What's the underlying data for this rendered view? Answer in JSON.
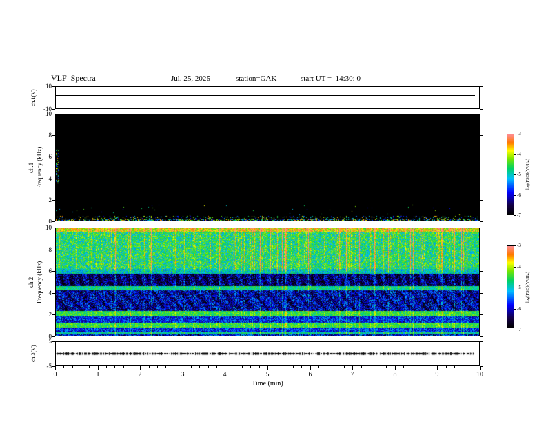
{
  "header": {
    "title": "VLF  Spectra",
    "date": "Jul. 25, 2025",
    "station": "station=GAK",
    "start_ut": "start UT =  14:30: 0"
  },
  "panels": {
    "ch1v": {
      "label": "ch.1(V)",
      "yticks": [
        "10",
        "-10"
      ],
      "ymin": -10,
      "ymax": 10
    },
    "ch1spec": {
      "label_line1": "ch.1",
      "label_line2": "Frequency (kHz)",
      "yticks": [
        "10",
        "8",
        "6",
        "4",
        "2",
        "0"
      ],
      "ymin": 0,
      "ymax": 10
    },
    "ch2spec": {
      "label_line1": "ch.2",
      "label_line2": "Frequency (kHz)",
      "yticks": [
        "10",
        "8",
        "6",
        "4",
        "2",
        "0"
      ],
      "ymin": 0,
      "ymax": 10
    },
    "ch3v": {
      "label": "ch.3(V)",
      "yticks": [
        "5",
        "-5"
      ],
      "ymin": -5,
      "ymax": 5
    }
  },
  "colorbar": {
    "label": "log(PSD)(V²/Hz)",
    "ticks": [
      "-3",
      "-4",
      "-5",
      "-6",
      "-7"
    ],
    "zmin": -7,
    "zmax": -3
  },
  "xaxis": {
    "label": "Time (min)",
    "ticks": [
      "0",
      "1",
      "2",
      "3",
      "4",
      "5",
      "6",
      "7",
      "8",
      "9",
      "10"
    ],
    "min": 0,
    "max": 10
  },
  "chart_data": [
    {
      "type": "line",
      "name": "ch.1 voltage monitor",
      "ylabel": "ch.1(V)",
      "ylim": [
        -10,
        10
      ],
      "xlim": [
        0,
        10
      ],
      "x": [
        0,
        9.9
      ],
      "values": [
        2.5,
        2.5
      ],
      "description": "flat constant trace near +2.5 V across the whole 10-minute record"
    },
    {
      "type": "heatmap",
      "subtype": "spectrogram",
      "name": "ch.1 VLF spectrogram",
      "xlabel": "Time (min)",
      "ylabel": "ch.1 Frequency (kHz)",
      "xlim": [
        0,
        10
      ],
      "ylim": [
        0,
        10
      ],
      "zlabel": "log(PSD)(V²/Hz)",
      "zlim": [
        -7,
        -3
      ],
      "seed": 11,
      "description": "power nearly everywhere at/below -7 (rendered black); sparse colored speckles in the first ~0.1 min between 3.5 and 6.8 kHz, and a thin band of scattered colored noise below ~0.4 kHz along the whole record"
    },
    {
      "type": "heatmap",
      "subtype": "spectrogram",
      "name": "ch.2 VLF spectrogram",
      "xlabel": "Time (min)",
      "ylabel": "ch.2 Frequency (kHz)",
      "xlim": [
        0,
        10
      ],
      "ylim": [
        0,
        10
      ],
      "zlabel": "log(PSD)(V²/Hz)",
      "zlim": [
        -7,
        -3
      ],
      "seed": 22,
      "bands": [
        {
          "f": [
            9.7,
            10.0
          ],
          "level": 0.8,
          "noise": 0.2
        },
        {
          "f": [
            6.2,
            9.7
          ],
          "level": 0.58,
          "noise": 0.18
        },
        {
          "f": [
            5.8,
            6.2
          ],
          "level": 0.5,
          "noise": 0.15
        },
        {
          "f": [
            4.6,
            5.8
          ],
          "level": 0.18,
          "noise": 0.22
        },
        {
          "f": [
            4.2,
            4.6
          ],
          "level": 0.55,
          "noise": 0.12
        },
        {
          "f": [
            2.3,
            4.2
          ],
          "level": 0.22,
          "noise": 0.22
        },
        {
          "f": [
            1.8,
            2.3
          ],
          "level": 0.62,
          "noise": 0.12
        },
        {
          "f": [
            1.2,
            1.8
          ],
          "level": 0.28,
          "noise": 0.18
        },
        {
          "f": [
            0.8,
            1.2
          ],
          "level": 0.62,
          "noise": 0.12
        },
        {
          "f": [
            0.35,
            0.8
          ],
          "level": 0.3,
          "noise": 0.18
        },
        {
          "f": [
            0.2,
            0.35
          ],
          "level": 0.55,
          "noise": 0.12
        },
        {
          "f": [
            0.0,
            0.2
          ],
          "level": 0.25,
          "noise": 0.25
        }
      ],
      "description": "broadband natural VLF noise: green/yellow hiss 6.2-10 kHz with many vertical sferic streaks; quieter dark-blue/black band 4.6-5.8 kHz with quasi-periodic black patches; bright narrowband cyan lines near 4.4, 2.0, 1.0 and 0.3 kHz; blue speckled background elsewhere below 4.5 kHz"
    },
    {
      "type": "line",
      "name": "ch.3 voltage monitor",
      "ylabel": "ch.3(V)",
      "ylim": [
        -5,
        5
      ],
      "xlim": [
        0,
        10
      ],
      "x": [
        0,
        9.9
      ],
      "values": [
        0,
        0
      ],
      "description": "thick noisy dark trace oscillating tightly around 0 V for the whole record"
    }
  ]
}
